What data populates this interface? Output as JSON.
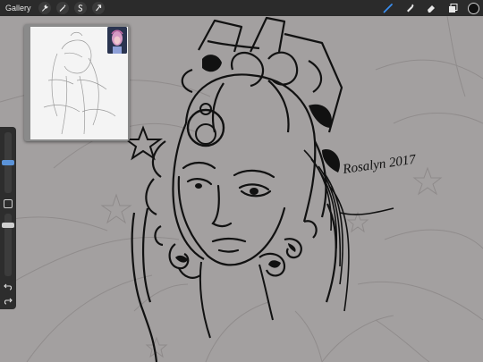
{
  "topbar": {
    "gallery_label": "Gallery",
    "left_tools": [
      {
        "name": "actions",
        "icon": "wrench-icon"
      },
      {
        "name": "adjustments",
        "icon": "magic-wand-icon"
      },
      {
        "name": "selection",
        "icon": "selection-s-icon"
      },
      {
        "name": "transform",
        "icon": "arrow-cursor-icon"
      }
    ],
    "right_tools": [
      {
        "name": "brush",
        "icon": "brush-icon",
        "active": true
      },
      {
        "name": "smudge",
        "icon": "smudge-icon",
        "active": false
      },
      {
        "name": "eraser",
        "icon": "eraser-icon",
        "active": false
      },
      {
        "name": "layers",
        "icon": "layers-icon",
        "active": false
      }
    ],
    "color": "#111111"
  },
  "sidebar": {
    "brush_size": 0.5,
    "opacity": 0.85,
    "undo_icon": "undo-icon",
    "redo_icon": "redo-icon"
  },
  "canvas": {
    "background": "#a3a0a0",
    "signature_text": "Rosalyn 2017"
  },
  "colors": {
    "toolbar": "#2b2b2b",
    "accent": "#3a8eef",
    "line": "#111111"
  }
}
